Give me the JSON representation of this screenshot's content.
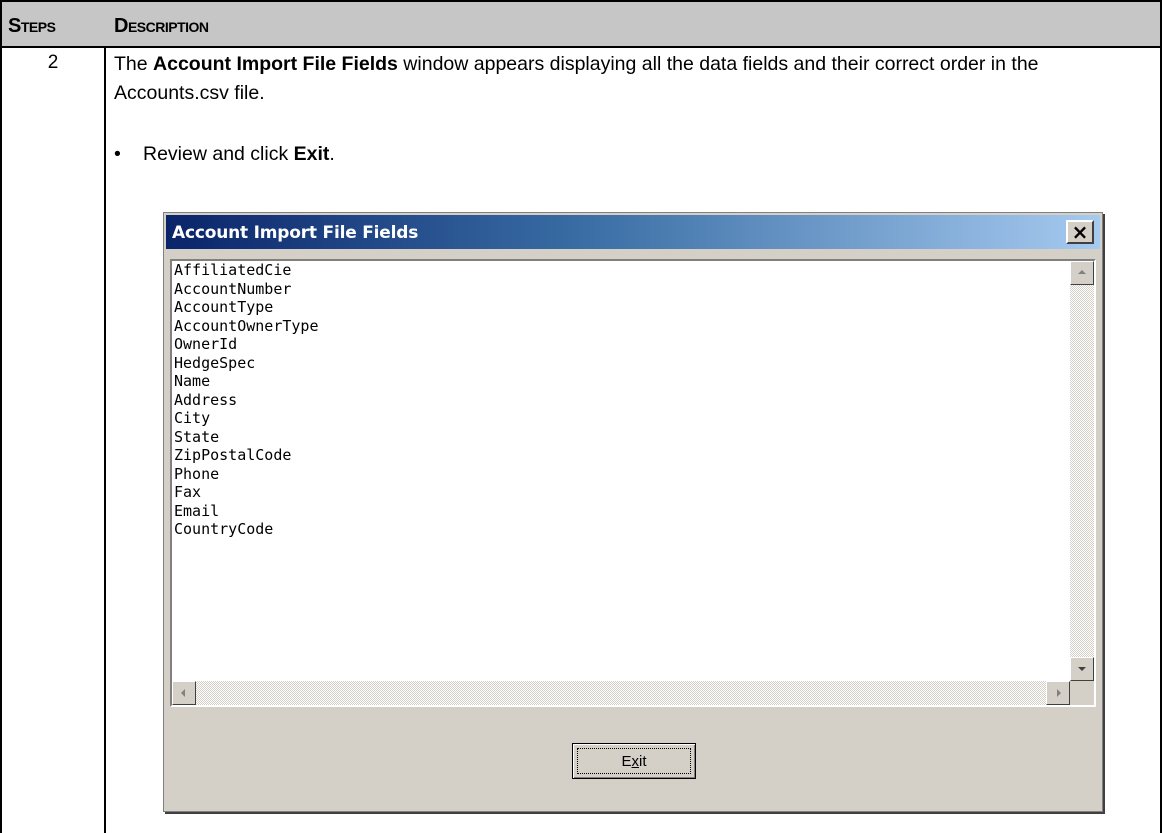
{
  "table": {
    "header_steps": "Steps",
    "header_description": "Description"
  },
  "row": {
    "step_number": "2",
    "para_prefix": "The ",
    "para_bold": "Account Import File Fields",
    "para_suffix": " window appears displaying all the data fields and their correct order in the Accounts.csv file.",
    "bullet_prefix": "Review and click ",
    "bullet_bold": "Exit",
    "bullet_suffix": "."
  },
  "window": {
    "title": "Account Import File Fields",
    "close_label": "×",
    "fields": [
      "AffiliatedCie",
      "AccountNumber",
      "AccountType",
      "AccountOwnerType",
      "OwnerId",
      "HedgeSpec",
      "Name",
      "Address",
      "City",
      "State",
      "ZipPostalCode",
      "Phone",
      "Fax",
      "Email",
      "CountryCode"
    ],
    "exit_before": "E",
    "exit_underlined": "x",
    "exit_after": "it"
  },
  "colors": {
    "header_bg": "#c6c6c6",
    "title_gradient_start": "#0a246a",
    "title_gradient_end": "#a6caf0",
    "window_bg": "#d4d0c8"
  }
}
